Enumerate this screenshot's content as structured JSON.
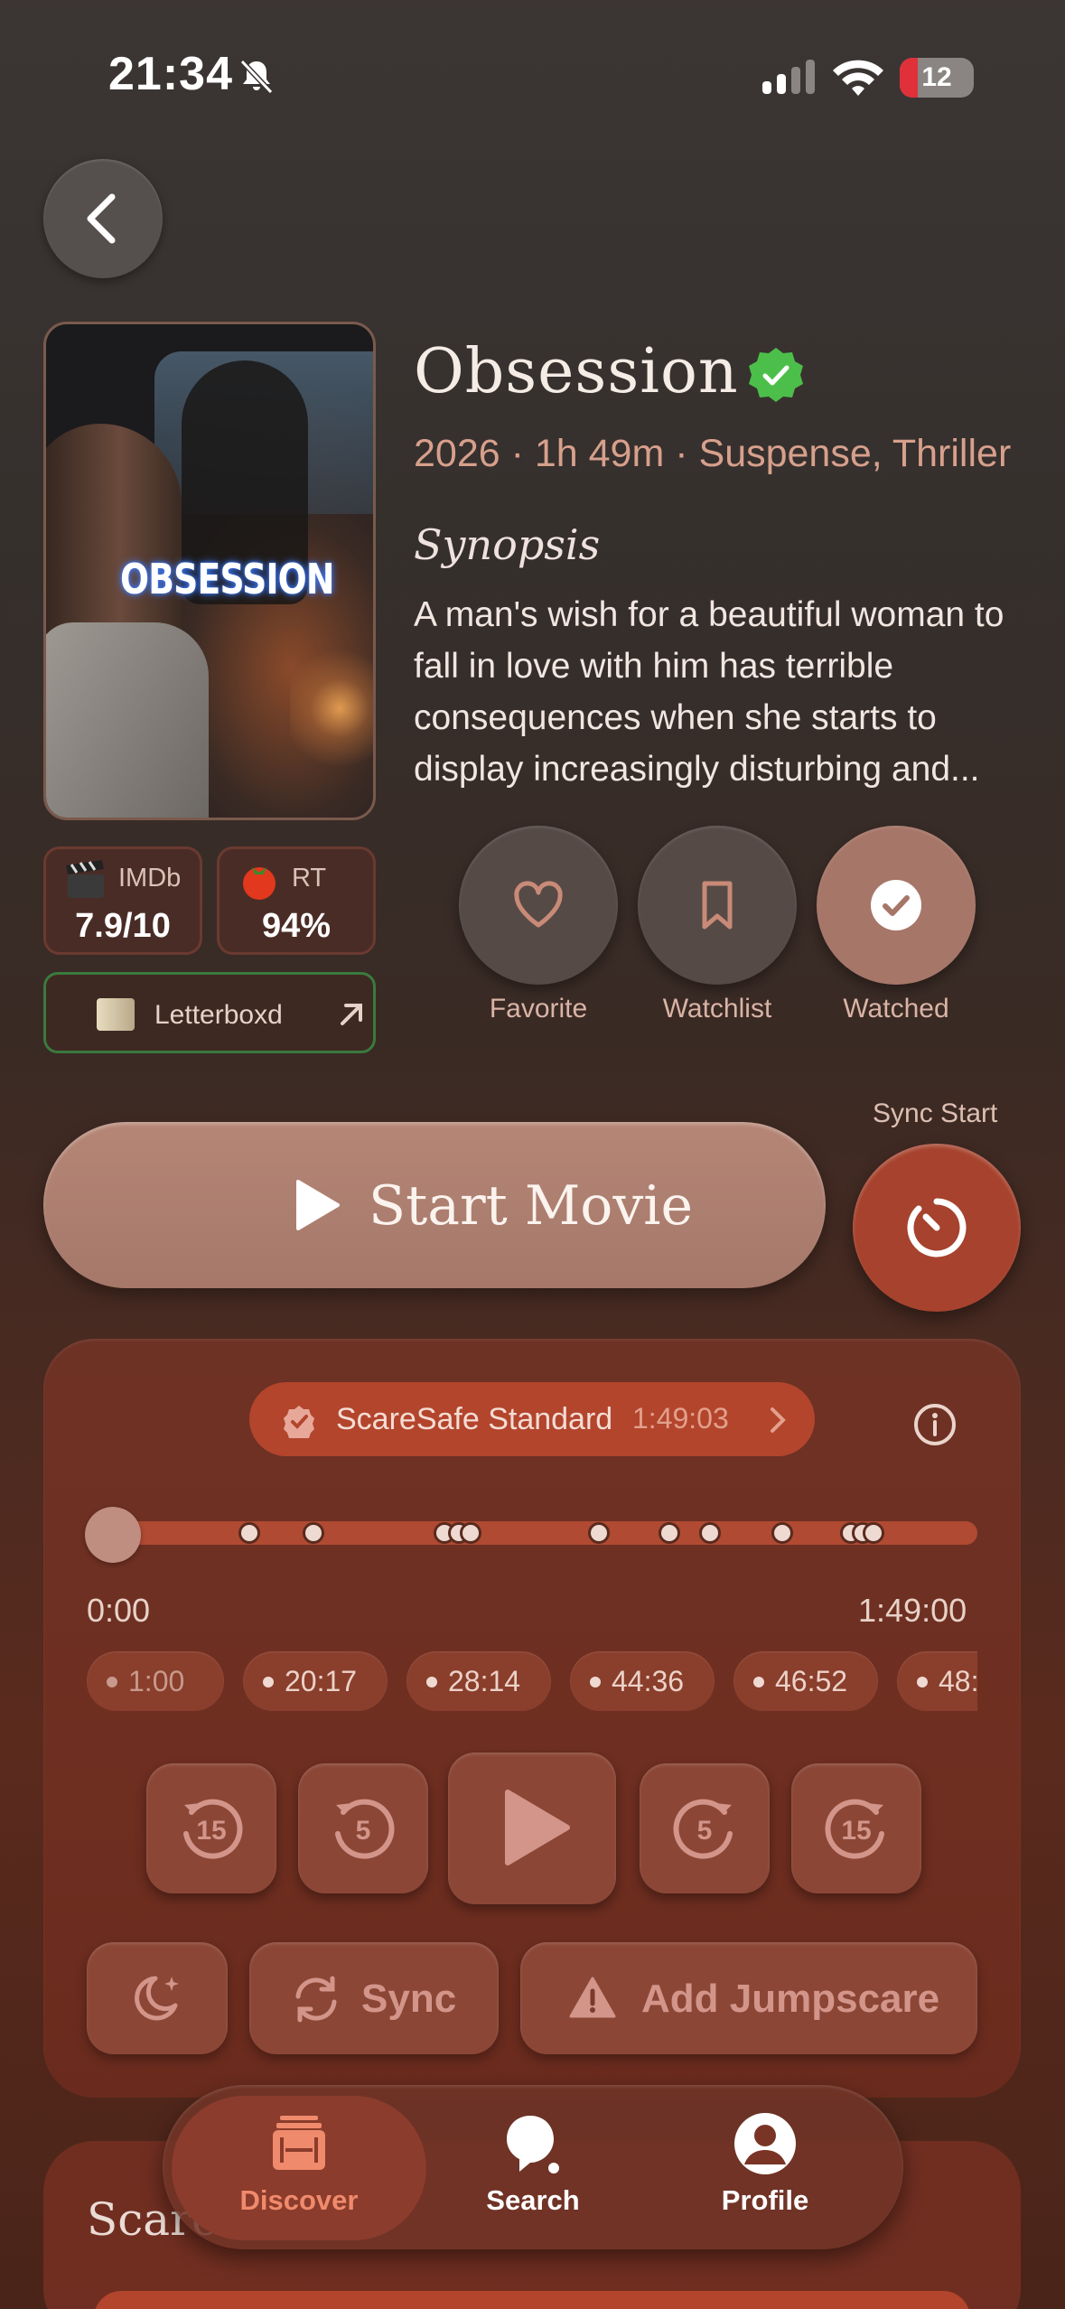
{
  "status_bar": {
    "time": "21:34",
    "battery": "12"
  },
  "movie": {
    "poster_title": "OBSESSION",
    "title": "Obsession",
    "meta": "2026 · 1h 49m · Suspense, Thriller",
    "synopsis_heading": "Synopsis",
    "synopsis": "A man's wish for a beautiful woman to fall in love with him has terrible consequences when she starts to display increasingly disturbing and..."
  },
  "ratings": {
    "imdb_label": "IMDb",
    "imdb_value": "7.9/10",
    "rt_label": "RT",
    "rt_value": "94%",
    "letterboxd_label": "Letterboxd"
  },
  "actions": {
    "favorite": "Favorite",
    "watchlist": "Watchlist",
    "watched": "Watched"
  },
  "start": {
    "label": "Start Movie",
    "sync_label": "Sync Start"
  },
  "player": {
    "mode_label": "ScareSafe Standard",
    "mode_duration": "1:49:03",
    "time_start": "0:00",
    "time_end": "1:49:00",
    "progress": 0,
    "marker_fractions": [
      0.183,
      0.255,
      0.402,
      0.418,
      0.431,
      0.575,
      0.654,
      0.7,
      0.781,
      0.858,
      0.871,
      0.883
    ],
    "jumpscares": [
      "1:00",
      "20:17",
      "28:14",
      "44:36",
      "46:52",
      "48:"
    ],
    "sync_label": "Sync",
    "add_label": "Add Jumpscare"
  },
  "section2": {
    "title": "Scare"
  },
  "tabs": {
    "discover": "Discover",
    "search": "Search",
    "profile": "Profile",
    "selected": "discover"
  },
  "colors": {
    "accent": "#b3452d",
    "verified": "#4cbf4a",
    "tab_selected": "#f08a6c"
  }
}
